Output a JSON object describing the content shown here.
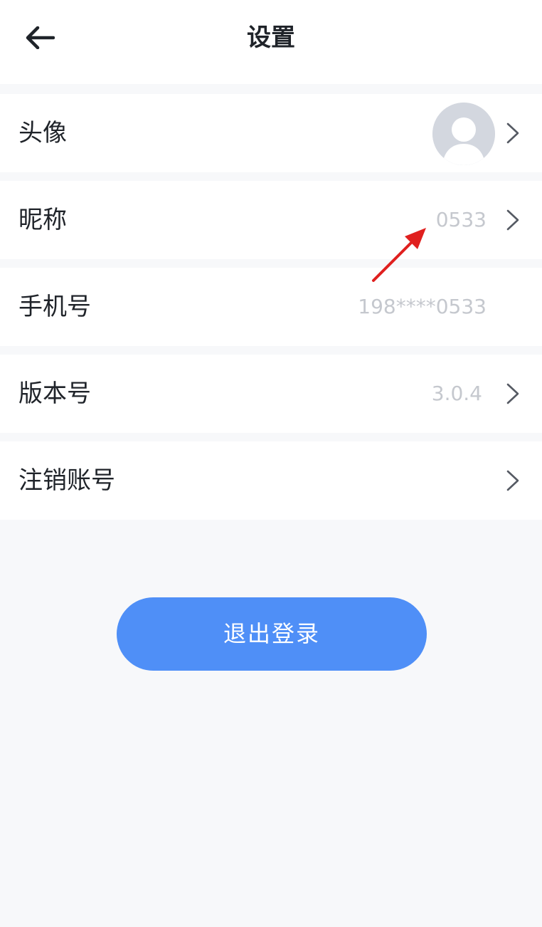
{
  "header": {
    "title": "设置",
    "back_icon": "arrow-left-icon"
  },
  "rows": [
    {
      "label": "头像",
      "value": "",
      "type": "avatar",
      "chevron": true
    },
    {
      "label": "昵称",
      "value": "0533",
      "type": "text",
      "chevron": true
    },
    {
      "label": "手机号",
      "value": "198****0533",
      "type": "text",
      "chevron": false
    },
    {
      "label": "版本号",
      "value": "3.0.4",
      "type": "text",
      "chevron": true
    },
    {
      "label": "注销账号",
      "value": "",
      "type": "none",
      "chevron": true
    }
  ],
  "logout": {
    "label": "退出登录"
  },
  "colors": {
    "accent": "#4f8ff7",
    "annotation": "#e0201f",
    "background": "#f7f8fa",
    "value_text": "#c5c8ce"
  }
}
